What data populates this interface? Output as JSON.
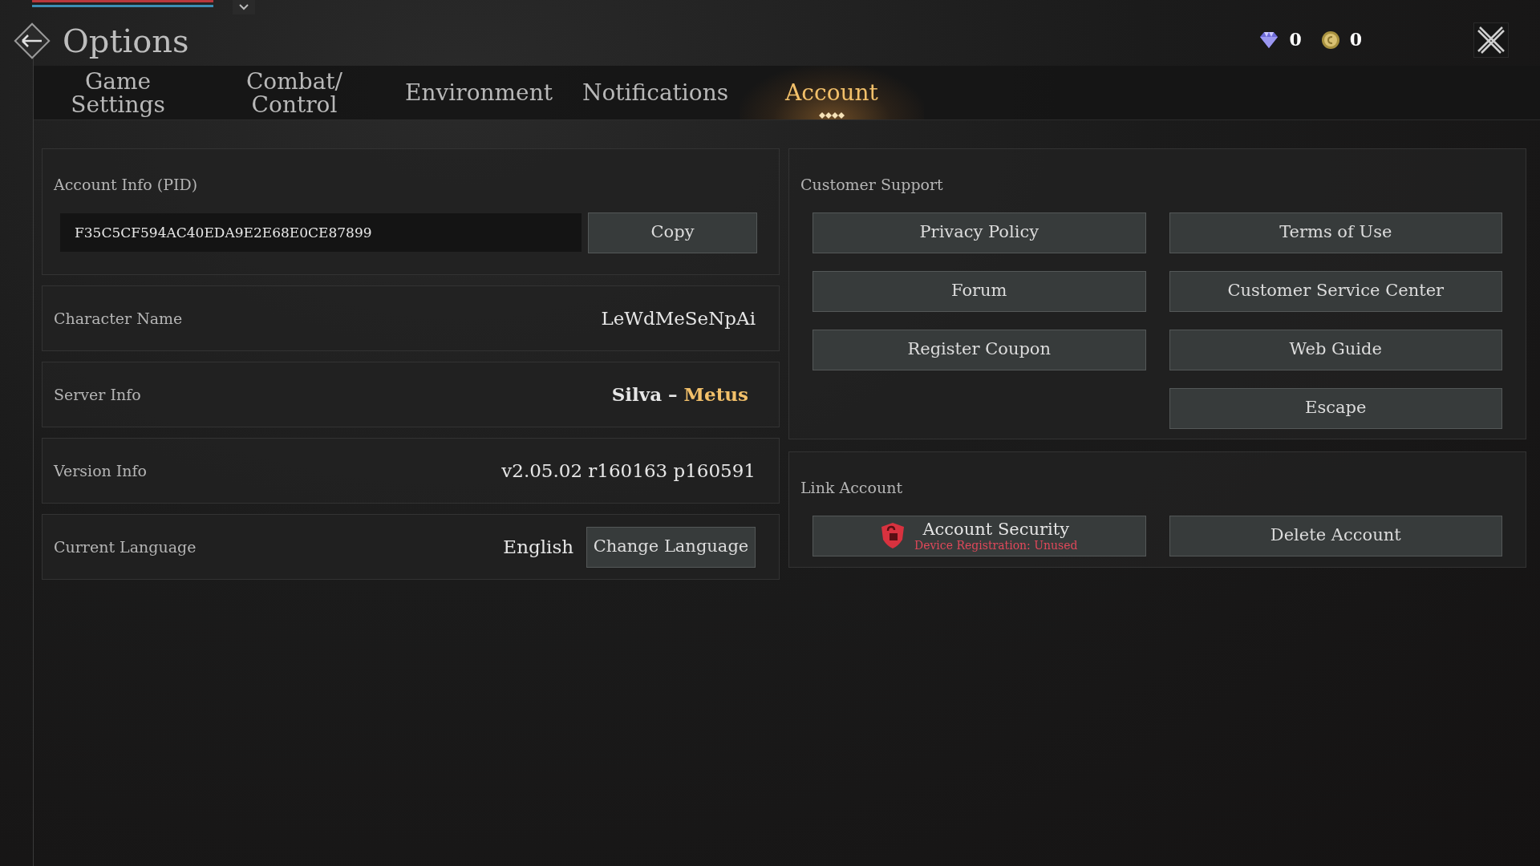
{
  "header": {
    "title": "Options",
    "currencies": [
      {
        "kind": "gem",
        "amount": "0"
      },
      {
        "kind": "coin",
        "amount": "0"
      }
    ]
  },
  "tabs": [
    {
      "lines": [
        "Game",
        "Settings"
      ],
      "selected": false
    },
    {
      "lines": [
        "Combat/",
        "Control"
      ],
      "selected": false
    },
    {
      "lines": [
        "Environment"
      ],
      "selected": false
    },
    {
      "lines": [
        "Notifications"
      ],
      "selected": false
    },
    {
      "lines": [
        "Account"
      ],
      "selected": true
    }
  ],
  "account_info": {
    "title": "Account Info (PID)",
    "pid": "F35C5CF594AC40EDA9E2E68E0CE87899",
    "button": "Copy"
  },
  "info_rows": [
    {
      "kind": "text",
      "label": "Character Name",
      "value": "LeWdMeSeNpAi"
    },
    {
      "kind": "server",
      "label": "Server Info",
      "server": "Silva",
      "separator": "–",
      "region": "Metus"
    },
    {
      "kind": "text",
      "label": "Version Info",
      "value": "v2.05.02 r160163 p160591"
    },
    {
      "kind": "language",
      "label": "Current Language",
      "value": "English",
      "button": "Change Language"
    }
  ],
  "customer_support": {
    "title": "Customer Support",
    "buttons": [
      "Privacy Policy",
      "Terms of Use",
      "Forum",
      "Customer Service Center",
      "Register Coupon",
      "Web Guide",
      "Escape"
    ]
  },
  "link_account": {
    "title": "Link Account",
    "buttons": [
      {
        "kind": "security",
        "label": "Account Security",
        "status": "Device Registration: Unused"
      },
      {
        "kind": "plain",
        "label": "Delete Account"
      }
    ]
  }
}
